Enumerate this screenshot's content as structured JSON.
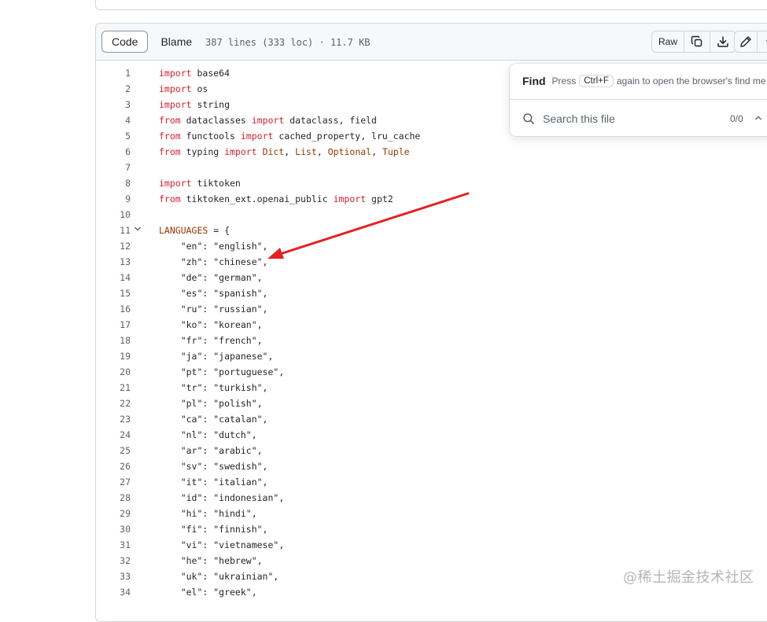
{
  "toolbar": {
    "code_label": "Code",
    "blame_label": "Blame",
    "file_info": "387 lines (333 loc) · 11.7 KB",
    "raw_label": "Raw"
  },
  "find": {
    "title": "Find",
    "press": "Press",
    "shortcut": "Ctrl+F",
    "hint": "again to open the browser's find me",
    "placeholder": "Search this file",
    "count": "0/0"
  },
  "code": {
    "lines": [
      {
        "n": "1",
        "t": "import base64"
      },
      {
        "n": "2",
        "t": "import os"
      },
      {
        "n": "3",
        "t": "import string"
      },
      {
        "n": "4",
        "t": "from dataclasses import dataclass, field"
      },
      {
        "n": "5",
        "t": "from functools import cached_property, lru_cache"
      },
      {
        "n": "6",
        "t": "from typing import Dict, List, Optional, Tuple"
      },
      {
        "n": "7",
        "t": ""
      },
      {
        "n": "8",
        "t": "import tiktoken"
      },
      {
        "n": "9",
        "t": "from tiktoken_ext.openai_public import gpt2"
      },
      {
        "n": "10",
        "t": ""
      },
      {
        "n": "11",
        "t": "LANGUAGES = {"
      },
      {
        "n": "12",
        "t": "    \"en\": \"english\","
      },
      {
        "n": "13",
        "t": "    \"zh\": \"chinese\","
      },
      {
        "n": "14",
        "t": "    \"de\": \"german\","
      },
      {
        "n": "15",
        "t": "    \"es\": \"spanish\","
      },
      {
        "n": "16",
        "t": "    \"ru\": \"russian\","
      },
      {
        "n": "17",
        "t": "    \"ko\": \"korean\","
      },
      {
        "n": "18",
        "t": "    \"fr\": \"french\","
      },
      {
        "n": "19",
        "t": "    \"ja\": \"japanese\","
      },
      {
        "n": "20",
        "t": "    \"pt\": \"portuguese\","
      },
      {
        "n": "21",
        "t": "    \"tr\": \"turkish\","
      },
      {
        "n": "22",
        "t": "    \"pl\": \"polish\","
      },
      {
        "n": "23",
        "t": "    \"ca\": \"catalan\","
      },
      {
        "n": "24",
        "t": "    \"nl\": \"dutch\","
      },
      {
        "n": "25",
        "t": "    \"ar\": \"arabic\","
      },
      {
        "n": "26",
        "t": "    \"sv\": \"swedish\","
      },
      {
        "n": "27",
        "t": "    \"it\": \"italian\","
      },
      {
        "n": "28",
        "t": "    \"id\": \"indonesian\","
      },
      {
        "n": "29",
        "t": "    \"hi\": \"hindi\","
      },
      {
        "n": "30",
        "t": "    \"fi\": \"finnish\","
      },
      {
        "n": "31",
        "t": "    \"vi\": \"vietnamese\","
      },
      {
        "n": "32",
        "t": "    \"he\": \"hebrew\","
      },
      {
        "n": "33",
        "t": "    \"uk\": \"ukrainian\","
      },
      {
        "n": "34",
        "t": "    \"el\": \"greek\","
      }
    ]
  },
  "watermark": "@稀土掘金技术社区",
  "icons": {
    "copy": "copy-icon",
    "download": "download-icon",
    "edit": "pencil-icon",
    "search": "search-icon"
  },
  "colors": {
    "keyword": "#cf222e",
    "name": "#953800",
    "arrow": "#e02424"
  }
}
